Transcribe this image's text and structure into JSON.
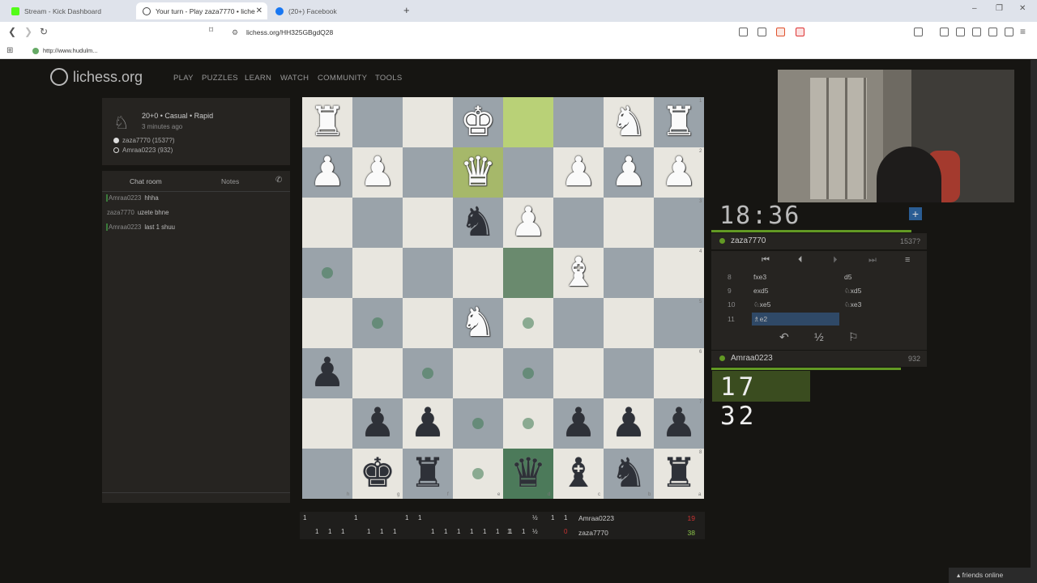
{
  "browser": {
    "tabs": [
      {
        "label": "Stream - Kick Dashboard",
        "favicon_color": "#53fc18"
      },
      {
        "label": "Your turn - Play zaza7770 • liche",
        "favicon_color": "#444444"
      },
      {
        "label": "(20+) Facebook",
        "favicon_color": "#1877f2"
      }
    ],
    "url": "lichess.org/HH325GBgdQ28",
    "bookmark": "http://www.hudulm..."
  },
  "site": {
    "logo": "lichess.org",
    "nav": [
      "PLAY",
      "PUZZLES",
      "LEARN",
      "WATCH",
      "COMMUNITY",
      "TOOLS"
    ]
  },
  "game_info": {
    "title": "20+0 • Casual • Rapid",
    "time": "3 minutes ago",
    "white": "zaza7770 (1537?)",
    "black": "Amraa0223 (932)"
  },
  "chat": {
    "tab_chat": "Chat room",
    "tab_notes": "Notes",
    "messages": [
      {
        "user": "Amraa0223",
        "text": "hhha"
      },
      {
        "user": "zaza7770",
        "text": "uzete bhne"
      },
      {
        "user": "Amraa0223",
        "text": "last 1 shuu"
      }
    ]
  },
  "board": {
    "orientation": "black",
    "pieces": [
      {
        "sq": "0,0",
        "p": "♜",
        "c": "w"
      },
      {
        "sq": "0,3",
        "p": "♚",
        "c": "w"
      },
      {
        "sq": "0,6",
        "p": "♞",
        "c": "w"
      },
      {
        "sq": "0,7",
        "p": "♜",
        "c": "w"
      },
      {
        "sq": "1,0",
        "p": "♟",
        "c": "w"
      },
      {
        "sq": "1,1",
        "p": "♟",
        "c": "w"
      },
      {
        "sq": "1,3",
        "p": "♛",
        "c": "w"
      },
      {
        "sq": "1,5",
        "p": "♟",
        "c": "w"
      },
      {
        "sq": "1,6",
        "p": "♟",
        "c": "w"
      },
      {
        "sq": "1,7",
        "p": "♟",
        "c": "w"
      },
      {
        "sq": "2,3",
        "p": "♞",
        "c": "b"
      },
      {
        "sq": "2,4",
        "p": "♟",
        "c": "w"
      },
      {
        "sq": "3,5",
        "p": "♝",
        "c": "w"
      },
      {
        "sq": "4,3",
        "p": "♞",
        "c": "w"
      },
      {
        "sq": "5,0",
        "p": "♟",
        "c": "b"
      },
      {
        "sq": "6,1",
        "p": "♟",
        "c": "b"
      },
      {
        "sq": "6,2",
        "p": "♟",
        "c": "b"
      },
      {
        "sq": "6,5",
        "p": "♟",
        "c": "b"
      },
      {
        "sq": "6,6",
        "p": "♟",
        "c": "b"
      },
      {
        "sq": "6,7",
        "p": "♟",
        "c": "b"
      },
      {
        "sq": "7,1",
        "p": "♚",
        "c": "b"
      },
      {
        "sq": "7,2",
        "p": "♜",
        "c": "b"
      },
      {
        "sq": "7,4",
        "p": "♛",
        "c": "b"
      },
      {
        "sq": "7,5",
        "p": "♝",
        "c": "b"
      },
      {
        "sq": "7,6",
        "p": "♞",
        "c": "b"
      },
      {
        "sq": "7,7",
        "p": "♜",
        "c": "b"
      }
    ],
    "files": [
      "h",
      "g",
      "f",
      "e",
      "d",
      "c",
      "b",
      "a"
    ],
    "ranks": [
      "1",
      "2",
      "3",
      "4",
      "5",
      "6",
      "7",
      "8"
    ]
  },
  "clocks": {
    "top_time": "18:36",
    "bottom_time": "17 32",
    "top_remaining": 0.93,
    "bottom_remaining": 0.88
  },
  "players": {
    "top": {
      "name": "zaza7770",
      "rating": "1537?"
    },
    "bottom": {
      "name": "Amraa0223",
      "rating": "932"
    }
  },
  "moves": [
    {
      "n": "8",
      "w": "fxe3",
      "b": "d5"
    },
    {
      "n": "9",
      "w": "exd5",
      "b": "♘xd5"
    },
    {
      "n": "10",
      "w": "♘xe5",
      "b": "♘xe3"
    },
    {
      "n": "11",
      "w": "♗e2",
      "b": ""
    }
  ],
  "actions": {
    "draw": "½"
  },
  "crosstable": {
    "row1": [
      "1",
      "1",
      "1",
      "1",
      "½",
      "1",
      "1"
    ],
    "row2": [
      "1",
      "1",
      "1",
      "1",
      "1",
      "1",
      "1",
      "1",
      "1",
      "1",
      "1",
      "1",
      "1",
      "1",
      "1",
      "½",
      "0"
    ],
    "p1_name": "Amraa0223",
    "p1_score": "19",
    "p2_name": "zaza7770",
    "p2_score": "38"
  },
  "friends": "friends online"
}
